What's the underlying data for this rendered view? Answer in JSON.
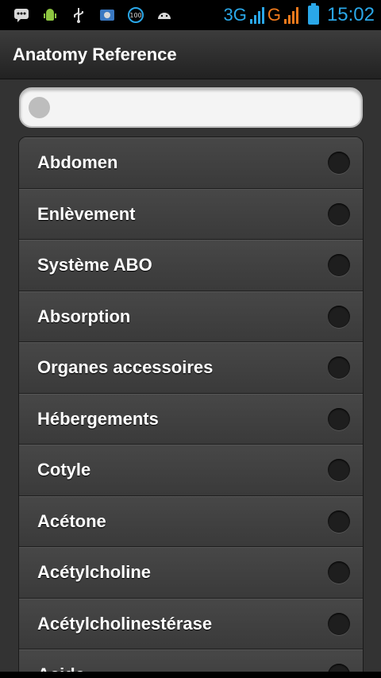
{
  "status_bar": {
    "icons": [
      "bbm-icon",
      "android-mascot-icon",
      "usb-icon",
      "photo-icon",
      "battery-100-icon",
      "android-debug-icon"
    ],
    "network_1": "3G",
    "network_2": "G",
    "time": "15:02",
    "colors": {
      "network_1": "#2aa7e8",
      "network_2": "#f07a1c"
    }
  },
  "header": {
    "title": "Anatomy Reference"
  },
  "search": {
    "value": "",
    "placeholder": ""
  },
  "list": {
    "items": [
      "Abdomen",
      "Enlèvement",
      "Système ABO",
      "Absorption",
      "Organes accessoires",
      "Hébergements",
      "Cotyle",
      "Acétone",
      "Acétylcholine",
      "Acétylcholinestérase",
      "Acide"
    ]
  }
}
